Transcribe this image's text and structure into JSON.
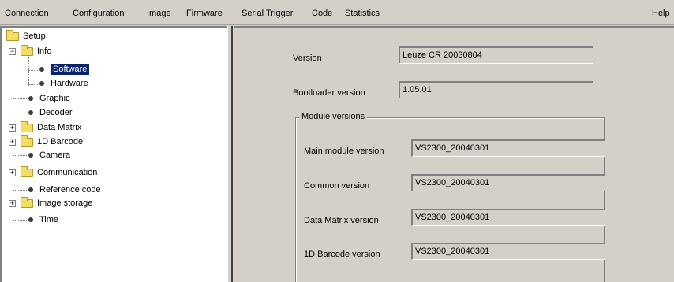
{
  "menu": {
    "connection": "Connection",
    "configuration": "Configuration",
    "image": "Image",
    "firmware": "Firmware",
    "serial_trigger": "Serial Trigger",
    "code": "Code",
    "statistics": "Statistics",
    "help": "Help"
  },
  "tree": {
    "setup": "Setup",
    "info": "Info",
    "software": "Software",
    "hardware": "Hardware",
    "graphic": "Graphic",
    "decoder": "Decoder",
    "data_matrix": "Data Matrix",
    "barcode_1d": "1D Barcode",
    "camera": "Camera",
    "communication": "Communication",
    "reference_code": "Reference code",
    "image_storage": "Image storage",
    "time": "Time"
  },
  "software": {
    "version_label": "Version",
    "version_value": "Leuze CR 20030804",
    "bootloader_label": "Bootloader version",
    "bootloader_value": "1.05.01",
    "module_group_title": "Module versions",
    "main_module_label": "Main module version",
    "main_module_value": "VS2300_20040301",
    "common_label": "Common version",
    "common_value": "VS2300_20040301",
    "data_matrix_label": "Data Matrix version",
    "data_matrix_value": "VS2300_20040301",
    "barcode_1d_label": "1D Barcode version",
    "barcode_1d_value": "VS2300_20040301"
  },
  "colors": {
    "window_bg": "#d4d0c8",
    "selection_bg": "#0a246a",
    "folder": "#f5dc63"
  }
}
